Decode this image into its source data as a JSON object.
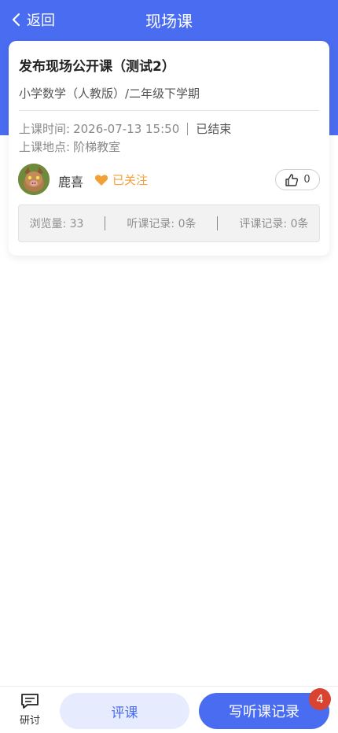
{
  "header": {
    "back_label": "返回",
    "title": "现场课",
    "color": "#4a6cf0"
  },
  "course": {
    "title": "发布现场公开课（测试2）",
    "subject": "小学数学（人教版）/二年级下学期",
    "time_label": "上课时间:",
    "time_value": "2026-07-13 15:50",
    "status": "已结束",
    "place_label": "上课地点:",
    "place_value": "阶梯教室"
  },
  "author": {
    "name": "鹿喜",
    "follow_label": "已关注",
    "follow_icon": "heart-icon",
    "follow_color": "#f2a03a"
  },
  "like": {
    "icon": "thumbs-up-icon",
    "count": "0"
  },
  "stats": {
    "views": "浏览量: 33",
    "listen_records": "听课记录: 0条",
    "review_records": "评课记录: 0条"
  },
  "bottom": {
    "discuss_label": "研讨",
    "discuss_icon": "chat-icon",
    "review_button": "评课",
    "write_button": "写听课记录",
    "badge_count": "4",
    "badge_color": "#d9432f"
  }
}
